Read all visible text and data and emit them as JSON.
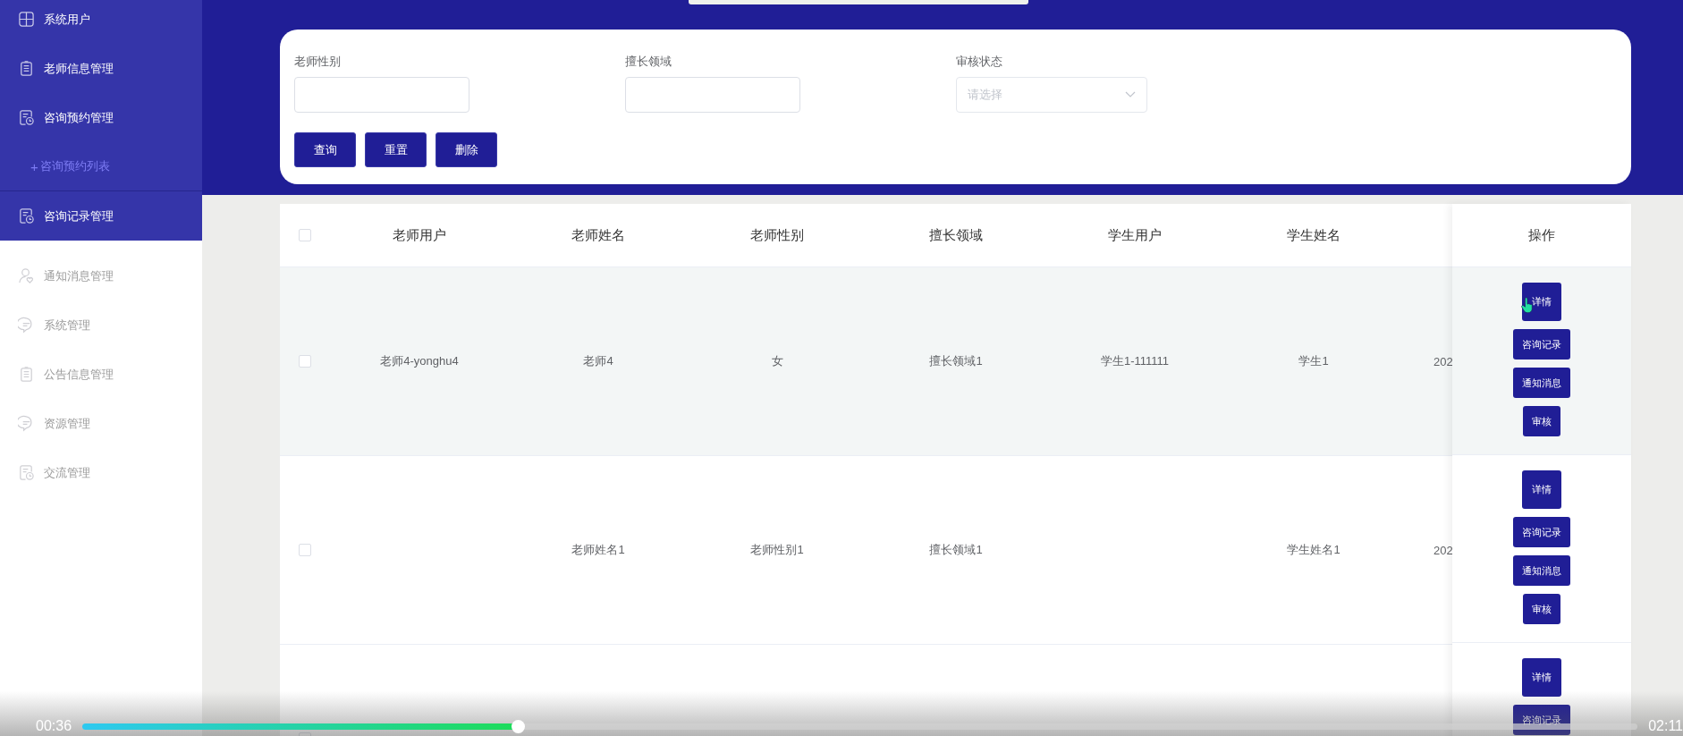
{
  "sidebar": {
    "items": [
      {
        "label": "系统用户",
        "highlighted": true
      },
      {
        "label": "老师信息管理",
        "highlighted": true
      },
      {
        "label": "咨询预约管理",
        "highlighted": true,
        "expanded": true,
        "children": [
          {
            "label": "咨询预约列表",
            "prefix": "+"
          }
        ]
      },
      {
        "label": "咨询记录管理",
        "highlighted": true
      },
      {
        "label": "通知消息管理",
        "highlighted": false
      },
      {
        "label": "系统管理",
        "highlighted": false
      },
      {
        "label": "公告信息管理",
        "highlighted": false
      },
      {
        "label": "资源管理",
        "highlighted": false
      },
      {
        "label": "交流管理",
        "highlighted": false
      }
    ]
  },
  "filters": [
    {
      "label": "老师性别",
      "kind": "text"
    },
    {
      "label": "擅长领域",
      "kind": "text"
    },
    {
      "label": "审核状态",
      "kind": "select",
      "placeholder": "请选择"
    }
  ],
  "filter_buttons": [
    "查询",
    "重置",
    "删除"
  ],
  "table": {
    "header_checkbox": {
      "checked": false
    },
    "columns": [
      "老师用户",
      "老师姓名",
      "老师性别",
      "擅长领域",
      "学生用户",
      "学生姓名"
    ],
    "action_column": "操作",
    "rows": [
      {
        "checked": false,
        "hovered": true,
        "cells": [
          "老师4-yonghu4",
          "老师4",
          "女",
          "擅长领域1",
          "学生1-111111",
          "学生1"
        ],
        "column_8": "202",
        "actions": [
          "详情",
          "咨询记录",
          "通知消息",
          "审核"
        ]
      },
      {
        "checked": false,
        "hovered": false,
        "cells": [
          "",
          "老师姓名1",
          "老师性别1",
          "擅长领域1",
          "",
          "学生姓名1"
        ],
        "column_8": "202",
        "actions": [
          "详情",
          "咨询记录",
          "通知消息",
          "审核"
        ]
      },
      {
        "checked": false,
        "hovered": false,
        "actions": [
          "详情",
          "咨询记录"
        ]
      }
    ]
  },
  "video_player": {
    "current_time": "00:36",
    "duration": "02:11",
    "level": 0.28
  }
}
